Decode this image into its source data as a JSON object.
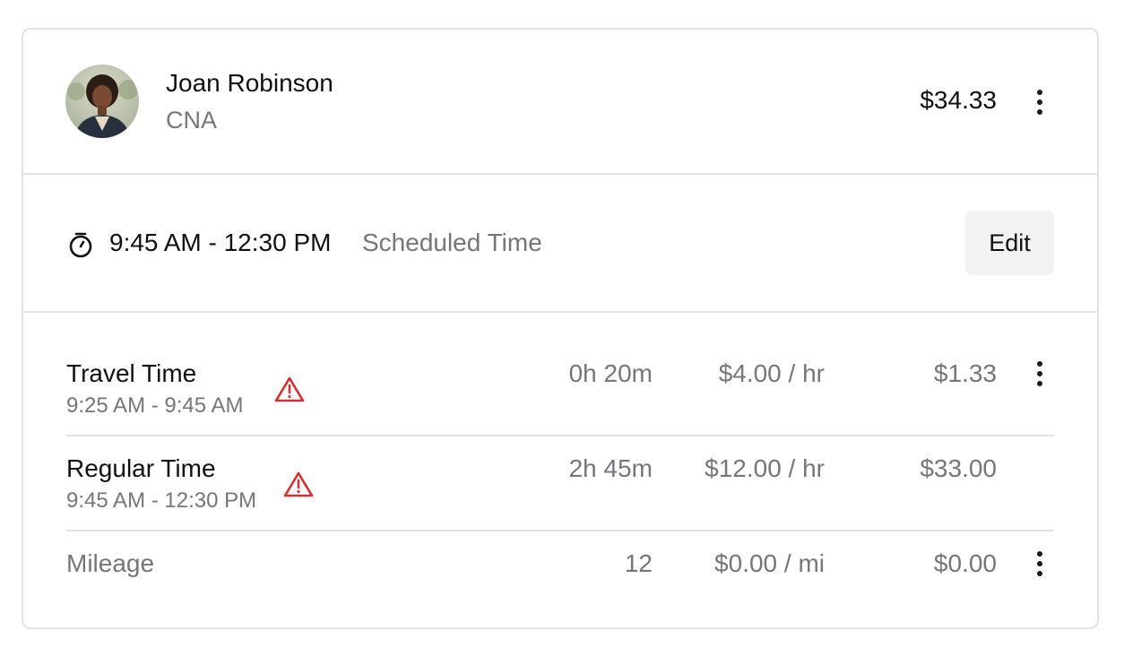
{
  "worker": {
    "name": "Joan Robinson",
    "role": "CNA",
    "total": "$34.33",
    "avatar_alt": "Joan Robinson avatar"
  },
  "schedule": {
    "time_range": "9:45 AM - 12:30 PM",
    "label": "Scheduled Time",
    "edit_label": "Edit",
    "icon": "stopwatch-icon"
  },
  "line_items": [
    {
      "title": "Travel Time",
      "time_range": "9:25 AM - 9:45 AM",
      "duration": "0h 20m",
      "rate": "$4.00 / hr",
      "amount": "$1.33",
      "warning": true,
      "has_menu": true
    },
    {
      "title": "Regular Time",
      "time_range": "9:45 AM - 12:30 PM",
      "duration": "2h 45m",
      "rate": "$12.00 / hr",
      "amount": "$33.00",
      "warning": true,
      "has_menu": false
    },
    {
      "title": "Mileage",
      "time_range": "",
      "duration": "12",
      "rate": "$0.00 / mi",
      "amount": "$0.00",
      "warning": false,
      "has_menu": true
    }
  ],
  "colors": {
    "warning": "#d32f2f",
    "muted_text": "#75757c",
    "border": "#e3e3e6",
    "button_bg": "#f2f2f3"
  }
}
